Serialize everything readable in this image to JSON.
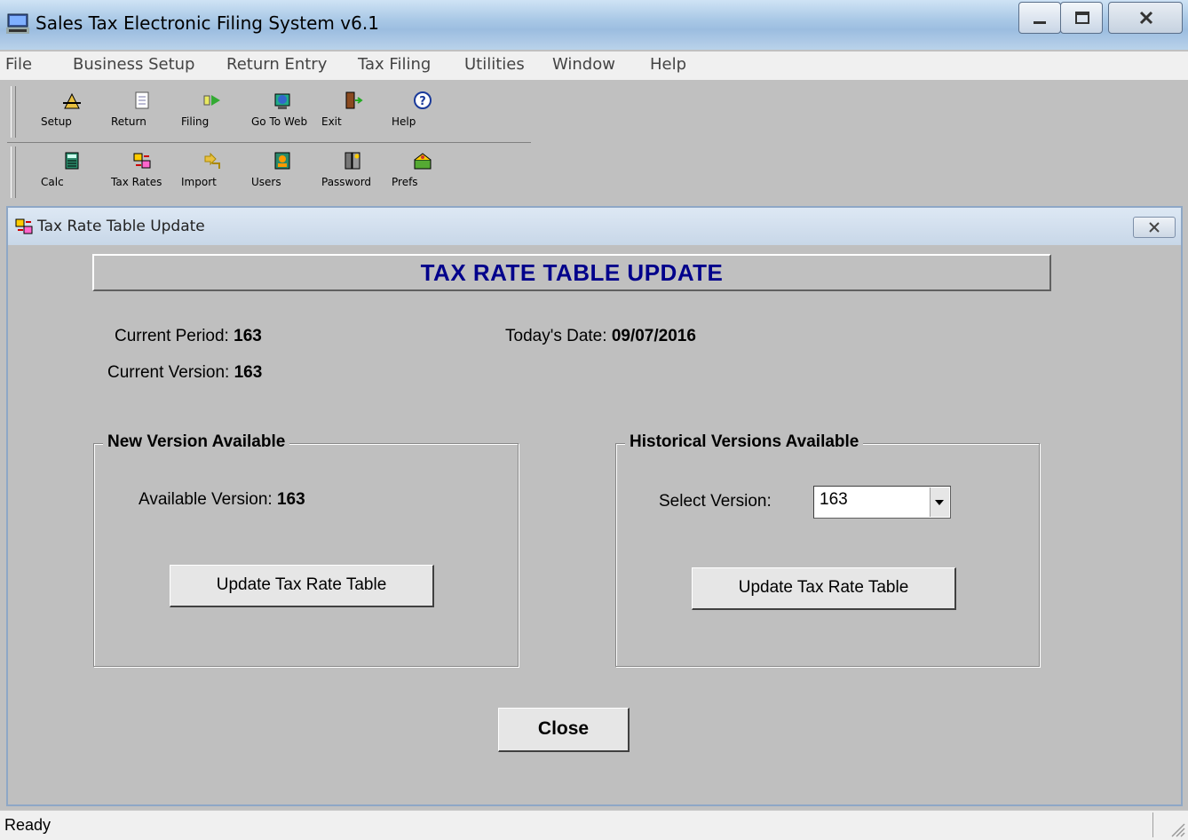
{
  "window": {
    "title": "Sales Tax Electronic Filing System v6.1"
  },
  "menu": [
    "File",
    "Business Setup",
    "Return Entry",
    "Tax Filing",
    "Utilities",
    "Window",
    "Help"
  ],
  "toolbar": {
    "row1": [
      {
        "label": "Setup",
        "icon": "setup-icon"
      },
      {
        "label": "Return",
        "icon": "return-icon"
      },
      {
        "label": "Filing",
        "icon": "filing-icon"
      },
      {
        "label": "Go To Web",
        "icon": "web-icon"
      },
      {
        "label": "Exit",
        "icon": "exit-icon"
      },
      {
        "label": "Help",
        "icon": "help-icon"
      }
    ],
    "row2": [
      {
        "label": "Calc",
        "icon": "calculator-icon"
      },
      {
        "label": "Tax Rates",
        "icon": "tax-rates-icon"
      },
      {
        "label": "Import",
        "icon": "import-icon"
      },
      {
        "label": "Users",
        "icon": "users-icon"
      },
      {
        "label": "Password",
        "icon": "password-icon"
      },
      {
        "label": "Prefs",
        "icon": "prefs-icon"
      }
    ]
  },
  "dialog": {
    "title": "Tax Rate Table Update",
    "banner": "TAX RATE TABLE UPDATE",
    "current_period_label": "Current Period:",
    "current_period": "163",
    "current_version_label": "Current Version:",
    "current_version": "163",
    "today_label": "Today's Date:",
    "today": "09/07/2016",
    "new_group": {
      "title": "New Version Available",
      "available_label": "Available Version:",
      "available": "163",
      "button": "Update Tax Rate Table"
    },
    "hist_group": {
      "title": "Historical Versions Available",
      "select_label": "Select Version:",
      "selected": "163",
      "button": "Update Tax Rate Table"
    },
    "close_button": "Close"
  },
  "status": {
    "text": "Ready"
  },
  "colors": {
    "banner_text": "#00008b",
    "titlebar": "#a9c8e6"
  }
}
